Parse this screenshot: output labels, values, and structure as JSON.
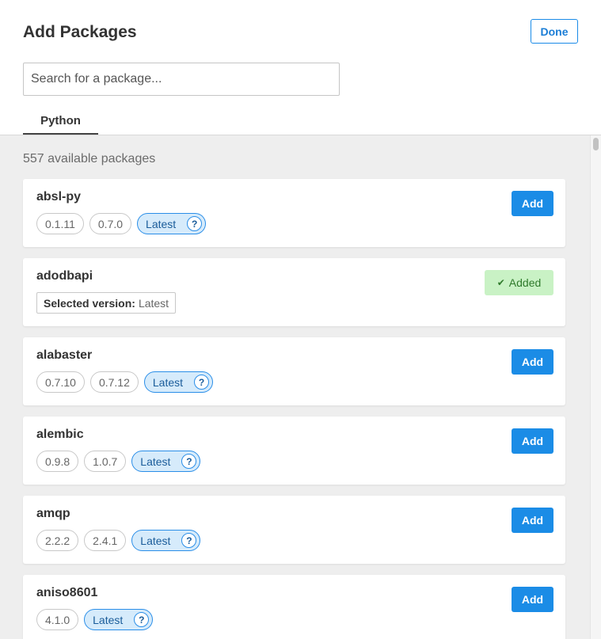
{
  "dialog": {
    "title": "Add Packages",
    "done_label": "Done",
    "search_placeholder": "Search for a package...",
    "tab_label": "Python",
    "available_count": "557 available packages",
    "add_label": "Add",
    "added_label": "Added",
    "selected_version_label": "Selected version:",
    "selected_version_value": "Latest",
    "question_mark": "?"
  },
  "packages": [
    {
      "name": "absl-py",
      "versions": [
        "0.1.11",
        "0.7.0"
      ],
      "latest": "Latest",
      "status": "add"
    },
    {
      "name": "adodbapi",
      "status": "added"
    },
    {
      "name": "alabaster",
      "versions": [
        "0.7.10",
        "0.7.12"
      ],
      "latest": "Latest",
      "status": "add"
    },
    {
      "name": "alembic",
      "versions": [
        "0.9.8",
        "1.0.7"
      ],
      "latest": "Latest",
      "status": "add"
    },
    {
      "name": "amqp",
      "versions": [
        "2.2.2",
        "2.4.1"
      ],
      "latest": "Latest",
      "status": "add"
    },
    {
      "name": "aniso8601",
      "versions": [
        "4.1.0"
      ],
      "latest": "Latest",
      "status": "add"
    }
  ],
  "colors": {
    "accent": "#1b8ce6",
    "added_bg": "#c9f2c5",
    "added_text": "#2f7a2b",
    "content_bg": "#eeeeee"
  }
}
